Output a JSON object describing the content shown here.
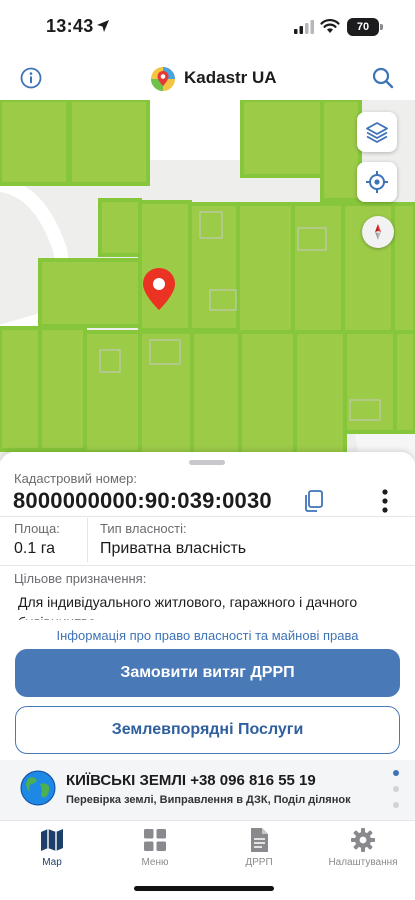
{
  "status_bar": {
    "time": "13:43",
    "battery": "70"
  },
  "nav": {
    "title": "Kadastr UA",
    "info_icon": "info-icon",
    "search_icon": "search-icon"
  },
  "map": {
    "layers_icon": "layers-icon",
    "locate_icon": "crosshair-icon",
    "compass_icon": "compass-icon",
    "pin_icon": "map-pin-icon",
    "colors": {
      "parcel_fill": "#9ccb48",
      "parcel_border": "#86c63a",
      "pin": "#ea3323",
      "background": "#eeeeec"
    }
  },
  "parcel": {
    "cadastral_label": "Кадастровий номер:",
    "cadastral_number": "8000000000:90:039:0030",
    "area_label": "Площа:",
    "area_value": "0.1 га",
    "ownership_label": "Тип власності:",
    "ownership_value": "Приватна власність",
    "purpose_label": "Цільове призначення:",
    "purpose_value": "Для індивідуального житлового, гаражного і дачного будівництва",
    "rights_link": "Інформація про право власності та майнові права",
    "order_button": "Замовити витяг ДРРП",
    "services_button": "Землевпорядні Послуги"
  },
  "promo": {
    "title": "КИЇВСЬКІ ЗЕМЛІ +38 096 816 55 19",
    "subtitle": "Перевірка землі, Виправлення в ДЗК, Поділ ділянок",
    "globe_icon": "globe-icon",
    "pages": 3,
    "active_page": 1
  },
  "tabs": [
    {
      "label": "Мар",
      "icon": "map-icon",
      "active": true
    },
    {
      "label": "Меню",
      "icon": "grid-icon",
      "active": false
    },
    {
      "label": "ДРРП",
      "icon": "document-icon",
      "active": false
    },
    {
      "label": "Налаштування",
      "icon": "gear-icon",
      "active": false
    }
  ],
  "colors": {
    "accent": "#4a79b8",
    "link": "#3e73b8",
    "tab_active": "#1f3f6b"
  }
}
